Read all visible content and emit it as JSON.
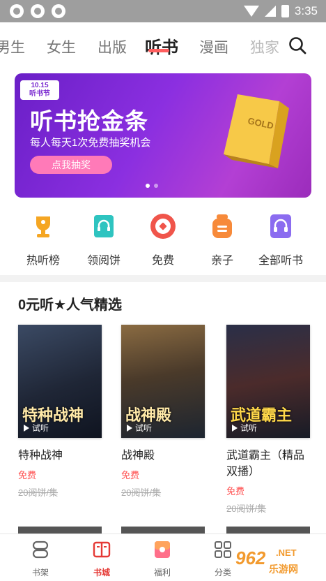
{
  "status_bar": {
    "time": "3:35"
  },
  "top_nav": {
    "tabs": [
      {
        "label": "男生"
      },
      {
        "label": "女生"
      },
      {
        "label": "出版"
      },
      {
        "label": "听书"
      },
      {
        "label": "漫画"
      },
      {
        "label": "独家"
      }
    ],
    "active_index": 3
  },
  "banner": {
    "badge_date": "10.15",
    "badge_label": "听书节",
    "title": "听书抢金条",
    "subtitle": "每人每天1次免费抽奖机会",
    "button": "点我抽奖",
    "gold_text": "GOLD"
  },
  "quick_links": [
    {
      "label": "热听榜",
      "icon": "trophy-icon",
      "color": "#f5a623"
    },
    {
      "label": "领阅饼",
      "icon": "ticket-icon",
      "color": "#2ec4c0"
    },
    {
      "label": "免费",
      "icon": "free-icon",
      "color": "#f0554b"
    },
    {
      "label": "亲子",
      "icon": "bag-icon",
      "color": "#f78a3a"
    },
    {
      "label": "全部听书",
      "icon": "headphone-icon",
      "color": "#8b6cf0"
    }
  ],
  "section": {
    "title": "0元听★人气精选"
  },
  "books": [
    {
      "title": "特种战神",
      "cover_name": "特种战神",
      "try_label": "试听",
      "free": "免费",
      "price": "20阅饼/集"
    },
    {
      "title": "战神殿",
      "cover_name": "战神殿",
      "try_label": "试听",
      "free": "免费",
      "price": "20阅饼/集"
    },
    {
      "title": "武道霸主（精品双播）",
      "cover_name": "武道霸主",
      "try_label": "试听",
      "free": "免费",
      "price": "20阅饼/集"
    }
  ],
  "bottom_nav": [
    {
      "label": "书架",
      "icon": "bookshelf-icon"
    },
    {
      "label": "书城",
      "icon": "bookstore-icon"
    },
    {
      "label": "福利",
      "icon": "gift-icon"
    },
    {
      "label": "分类",
      "icon": "category-icon"
    }
  ],
  "watermark": {
    "text": "乐游网"
  },
  "colors": {
    "accent": "#e53935",
    "banner": "#8b2fe0"
  }
}
